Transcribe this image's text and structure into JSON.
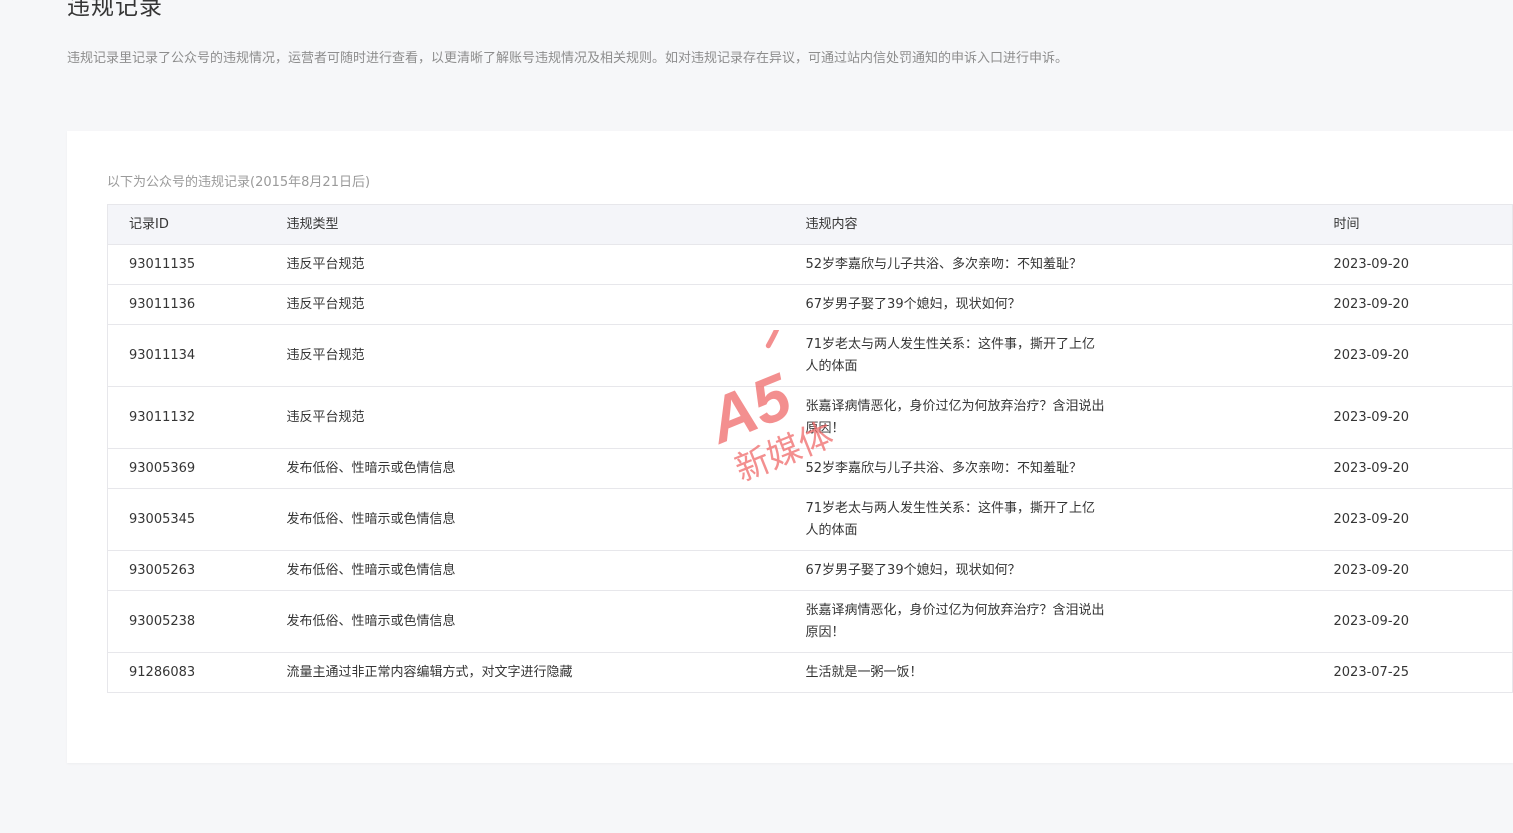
{
  "page": {
    "title": "违规记录",
    "description": "违规记录里记录了公众号的违规情况，运营者可随时进行查看，以更清晰了解账号违规情况及相关规则。如对违规记录存在异议，可通过站内信处罚通知的申诉入口进行申诉。"
  },
  "records": {
    "caption": "以下为公众号的违规记录(2015年8月21日后)",
    "headers": {
      "id": "记录ID",
      "type": "违规类型",
      "content": "违规内容",
      "time": "时间"
    },
    "rows": [
      {
        "id": "93011135",
        "type": "违反平台规范",
        "content": "52岁李嘉欣与儿子共浴、多次亲吻：不知羞耻？",
        "time": "2023-09-20"
      },
      {
        "id": "93011136",
        "type": "违反平台规范",
        "content": "67岁男子娶了39个媳妇，现状如何？",
        "time": "2023-09-20"
      },
      {
        "id": "93011134",
        "type": "违反平台规范",
        "content": "71岁老太与两人发生性关系：这件事，撕开了上亿人的体面",
        "time": "2023-09-20"
      },
      {
        "id": "93011132",
        "type": "违反平台规范",
        "content": "张嘉译病情恶化，身价过亿为何放弃治疗？含泪说出原因！",
        "time": "2023-09-20"
      },
      {
        "id": "93005369",
        "type": "发布低俗、性暗示或色情信息",
        "content": "52岁李嘉欣与儿子共浴、多次亲吻：不知羞耻？",
        "time": "2023-09-20"
      },
      {
        "id": "93005345",
        "type": "发布低俗、性暗示或色情信息",
        "content": "71岁老太与两人发生性关系：这件事，撕开了上亿人的体面",
        "time": "2023-09-20"
      },
      {
        "id": "93005263",
        "type": "发布低俗、性暗示或色情信息",
        "content": "67岁男子娶了39个媳妇，现状如何？",
        "time": "2023-09-20"
      },
      {
        "id": "93005238",
        "type": "发布低俗、性暗示或色情信息",
        "content": "张嘉译病情恶化，身价过亿为何放弃治疗？含泪说出原因！",
        "time": "2023-09-20"
      },
      {
        "id": "91286083",
        "type": "流量主通过非正常内容编辑方式，对文字进行隐藏",
        "content": "生活就是一粥一饭！",
        "time": "2023-07-25"
      }
    ]
  },
  "watermark": {
    "logo_text": "A5",
    "subtitle": "新媒体",
    "color": "#f06a6a"
  },
  "colors": {
    "background": "#f6f7f9",
    "card": "#ffffff",
    "header_row": "#f4f5f9",
    "border": "#e7e7eb",
    "muted_text": "#8d8d8d"
  }
}
